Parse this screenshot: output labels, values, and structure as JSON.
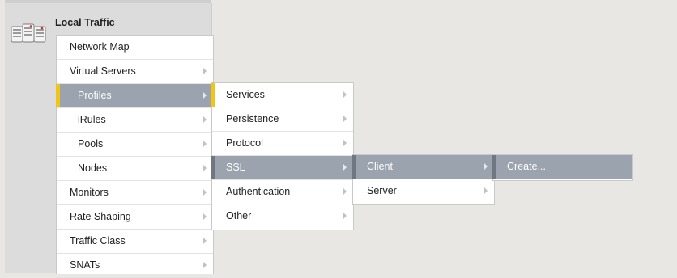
{
  "sidebar": {
    "section_title": "Local Traffic",
    "icon": "server-rack-icon"
  },
  "menu_level1": {
    "items": [
      {
        "label": "Network Map"
      },
      {
        "label": "Virtual Servers"
      },
      {
        "label": "Profiles"
      },
      {
        "label": "iRules"
      },
      {
        "label": "Pools"
      },
      {
        "label": "Nodes"
      },
      {
        "label": "Monitors"
      },
      {
        "label": "Rate Shaping"
      },
      {
        "label": "Traffic Class"
      },
      {
        "label": "SNATs"
      }
    ]
  },
  "menu_profiles": {
    "items": [
      {
        "label": "Services"
      },
      {
        "label": "Persistence"
      },
      {
        "label": "Protocol"
      },
      {
        "label": "SSL"
      },
      {
        "label": "Authentication"
      },
      {
        "label": "Other"
      }
    ]
  },
  "menu_ssl": {
    "items": [
      {
        "label": "Client"
      },
      {
        "label": "Server"
      }
    ]
  },
  "menu_client": {
    "items": [
      {
        "label": "Create..."
      }
    ]
  },
  "colors": {
    "active_bg": "#9aa3ae",
    "accent_yellow": "#f0c419",
    "accent_gray": "#6f7782",
    "page_bg": "#e8e7e3"
  }
}
